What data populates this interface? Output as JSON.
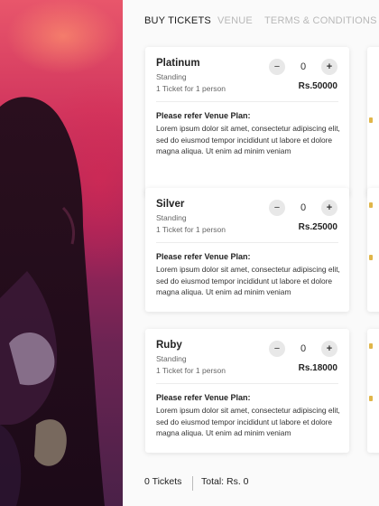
{
  "tabs": [
    {
      "label": "BUY TICKETS",
      "active": true
    },
    {
      "label": "VENUE",
      "active": false
    },
    {
      "label": "TERMS & CONDITIONS",
      "active": false
    }
  ],
  "tickets": [
    {
      "name": "Platinum",
      "type": "Standing",
      "capacity": "1 Ticket for 1 person",
      "quantity": "0",
      "price": "Rs.50000",
      "plan_title": "Please refer Venue Plan:",
      "plan_text": "Lorem ipsum dolor sit amet, consectetur adipiscing elit, sed do eiusmod tempor incididunt ut labore et dolore magna aliqua. Ut enim ad minim veniam"
    },
    {
      "name": "Silver",
      "type": "Standing",
      "capacity": "1 Ticket for 1 person",
      "quantity": "0",
      "price": "Rs.25000",
      "plan_title": "Please refer Venue Plan:",
      "plan_text": "Lorem ipsum dolor sit amet, consectetur adipiscing elit, sed do eiusmod tempor incididunt ut labore et dolore magna aliqua. Ut enim ad minim veniam"
    },
    {
      "name": "Ruby",
      "type": "Standing",
      "capacity": "1 Ticket for 1 person",
      "quantity": "0",
      "price": "Rs.18000",
      "plan_title": "Please refer Venue Plan:",
      "plan_text": "Lorem ipsum dolor sit amet, consectetur adipiscing elit, sed do eiusmod tempor incididunt ut labore et dolore magna aliqua. Ut enim ad minim veniam"
    }
  ],
  "stepper": {
    "minus": "−",
    "plus": "+"
  },
  "summary": {
    "tickets": "0 Tickets",
    "total": "Total: Rs. 0"
  },
  "colors": {
    "accent_peek": "#e0b64a",
    "hero_top": "#e8566b",
    "hero_bottom": "#4a2148"
  },
  "icons": {
    "minus": "minus-icon",
    "plus": "plus-icon"
  }
}
